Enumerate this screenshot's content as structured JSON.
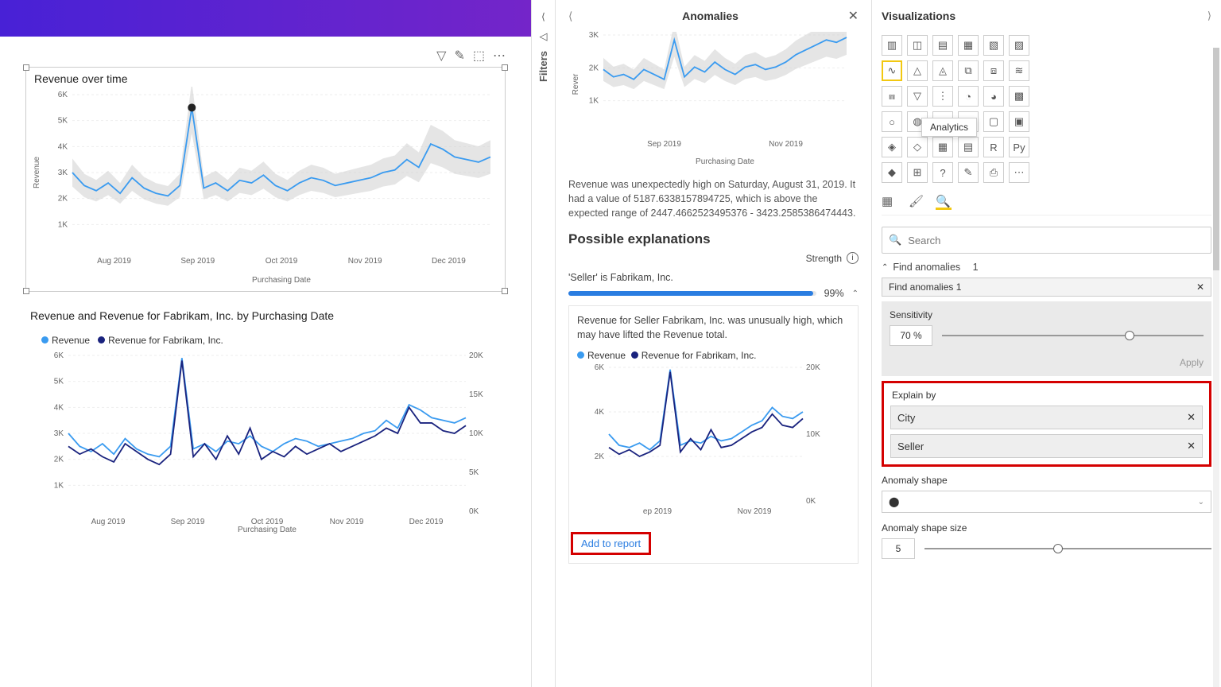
{
  "canvas": {
    "chart1_title": "Revenue over time",
    "chart2_title": "Revenue and Revenue for Fabrikam, Inc. by Purchasing Date",
    "legend_revenue": "Revenue",
    "legend_fabrikam": "Revenue for Fabrikam, Inc.",
    "x_axis_label": "Purchasing Date",
    "y_axis_label": "Revenue"
  },
  "filters": {
    "label": "Filters"
  },
  "anomalies": {
    "title": "Anomalies",
    "mini_xlabel": "Purchasing Date",
    "mini_ylabel": "Rever",
    "description": "Revenue was unexpectedly high on Saturday, August 31, 2019. It had a value of 5187.6338157894725, which is above the expected range of 2447.4662523495376 - 3423.2585386474443.",
    "possible_title": "Possible explanations",
    "strength_label": "Strength",
    "explanation_label": "'Seller' is Fabrikam, Inc.",
    "strength_pct": "99%",
    "card_text": "Revenue for Seller Fabrikam, Inc. was unusually high, which may have lifted the Revenue total.",
    "card_legend_revenue": "Revenue",
    "card_legend_fabrikam": "Revenue for Fabrikam, Inc.",
    "card_x_tick1": "ep 2019",
    "card_x_tick2": "Nov 2019",
    "add_report": "Add to report"
  },
  "viz": {
    "title": "Visualizations",
    "tooltip": "Analytics",
    "search_placeholder": "Search",
    "find_label": "Find anomalies",
    "find_count": "1",
    "find_pill": "Find anomalies 1",
    "sensitivity_label": "Sensitivity",
    "sensitivity_value": "70  %",
    "apply": "Apply",
    "explain_by": "Explain by",
    "field_city": "City",
    "field_seller": "Seller",
    "shape_label": "Anomaly shape",
    "shape_size_label": "Anomaly shape size",
    "shape_size_value": "5",
    "icons": [
      "stacked-bar",
      "clustered-bar",
      "stacked-col",
      "clustered-col",
      "100-bar",
      "100-col",
      "line",
      "area",
      "stacked-area",
      "line-col",
      "line-col2",
      "ribbon",
      "waterfall",
      "funnel",
      "scatter",
      "pie",
      "donut",
      "treemap",
      "map",
      "filled-map",
      "azure-map",
      "gauge",
      "card",
      "multi-card",
      "kpi",
      "slicer",
      "table",
      "matrix",
      "r",
      "py",
      "key-influencer",
      "decomp",
      "qa",
      "narrative",
      "paginated",
      "more"
    ]
  },
  "chart_data": [
    {
      "type": "line",
      "title": "Revenue over time",
      "xlabel": "Purchasing Date",
      "ylabel": "Revenue",
      "ylim": [
        0,
        6000
      ],
      "y_ticks": [
        "1K",
        "2K",
        "3K",
        "4K",
        "5K",
        "6K"
      ],
      "x_ticks": [
        "Aug 2019",
        "Sep 2019",
        "Oct 2019",
        "Nov 2019",
        "Dec 2019"
      ],
      "anomaly_point": {
        "x": "2019-08-31",
        "y": 5188
      },
      "confidence_band": true,
      "series": [
        {
          "name": "Revenue",
          "color": "#3a9bf0",
          "values": [
            3000,
            2500,
            2300,
            2600,
            2200,
            2800,
            2400,
            2200,
            2100,
            2500,
            5500,
            2400,
            2600,
            2300,
            2700,
            2600,
            2900,
            2500,
            2300,
            2600,
            2800,
            2700,
            2500,
            2600,
            2700,
            2800,
            3000,
            3100,
            3500,
            3200,
            4100,
            3900,
            3600,
            3500,
            3400,
            3600
          ]
        }
      ]
    },
    {
      "type": "line",
      "title": "Revenue and Revenue for Fabrikam, Inc. by Purchasing Date",
      "xlabel": "Purchasing Date",
      "ylim_left": [
        0,
        6000
      ],
      "ylim_right": [
        0,
        20000
      ],
      "y_ticks_left": [
        "1K",
        "2K",
        "3K",
        "4K",
        "5K",
        "6K"
      ],
      "y_ticks_right": [
        "0K",
        "5K",
        "10K",
        "15K",
        "20K"
      ],
      "x_ticks": [
        "Aug 2019",
        "Sep 2019",
        "Oct 2019",
        "Nov 2019",
        "Dec 2019"
      ],
      "series": [
        {
          "name": "Revenue",
          "color": "#3a9bf0",
          "values": [
            3000,
            2500,
            2300,
            2600,
            2200,
            2800,
            2400,
            2200,
            2100,
            2500,
            5900,
            2400,
            2600,
            2300,
            2700,
            2600,
            2900,
            2500,
            2300,
            2600,
            2800,
            2700,
            2500,
            2600,
            2700,
            2800,
            3000,
            3100,
            3500,
            3200,
            4100,
            3900,
            3600,
            3500,
            3400,
            3600
          ]
        },
        {
          "name": "Revenue for Fabrikam, Inc.",
          "color": "#1a237e",
          "values": [
            2500,
            2200,
            2400,
            2100,
            1900,
            2600,
            2300,
            2000,
            1800,
            2200,
            5800,
            2100,
            2600,
            2000,
            2900,
            2200,
            3200,
            2000,
            2300,
            2100,
            2500,
            2200,
            2400,
            2600,
            2300,
            2500,
            2700,
            2900,
            3200,
            3000,
            4000,
            3400,
            3400,
            3100,
            3000,
            3300
          ]
        }
      ]
    },
    {
      "type": "line",
      "title": "Anomalies mini chart",
      "xlabel": "Purchasing Date",
      "ylabel": "Rever",
      "ylim": [
        0,
        4000
      ],
      "y_ticks": [
        "1K",
        "2K",
        "3K"
      ],
      "x_ticks": [
        "Sep 2019",
        "Nov 2019"
      ],
      "confidence_band": true,
      "series": [
        {
          "name": "Revenue",
          "color": "#3a9bf0",
          "values": [
            2600,
            2300,
            2400,
            2200,
            2600,
            2400,
            2200,
            3800,
            2300,
            2700,
            2500,
            2900,
            2600,
            2400,
            2700,
            2800,
            2600,
            2700,
            2900,
            3200,
            3400,
            3600,
            3800,
            3700,
            3900
          ]
        }
      ]
    },
    {
      "type": "line",
      "title": "Explanation card mini chart",
      "ylim_left": [
        0,
        6000
      ],
      "ylim_right": [
        0,
        20000
      ],
      "y_ticks_left": [
        "2K",
        "4K",
        "6K"
      ],
      "y_ticks_right": [
        "0K",
        "10K",
        "20K"
      ],
      "x_ticks": [
        "ep 2019",
        "Nov 2019"
      ],
      "series": [
        {
          "name": "Revenue",
          "color": "#3a9bf0",
          "values": [
            3000,
            2500,
            2400,
            2600,
            2300,
            2700,
            5900,
            2500,
            2700,
            2600,
            2900,
            2700,
            2800,
            3100,
            3400,
            3600,
            4200,
            3800,
            3700,
            4000
          ]
        },
        {
          "name": "Revenue for Fabrikam, Inc.",
          "color": "#1a237e",
          "values": [
            2400,
            2100,
            2300,
            2000,
            2200,
            2500,
            5800,
            2200,
            2800,
            2300,
            3200,
            2400,
            2500,
            2800,
            3100,
            3300,
            3900,
            3400,
            3300,
            3700
          ]
        }
      ]
    }
  ]
}
